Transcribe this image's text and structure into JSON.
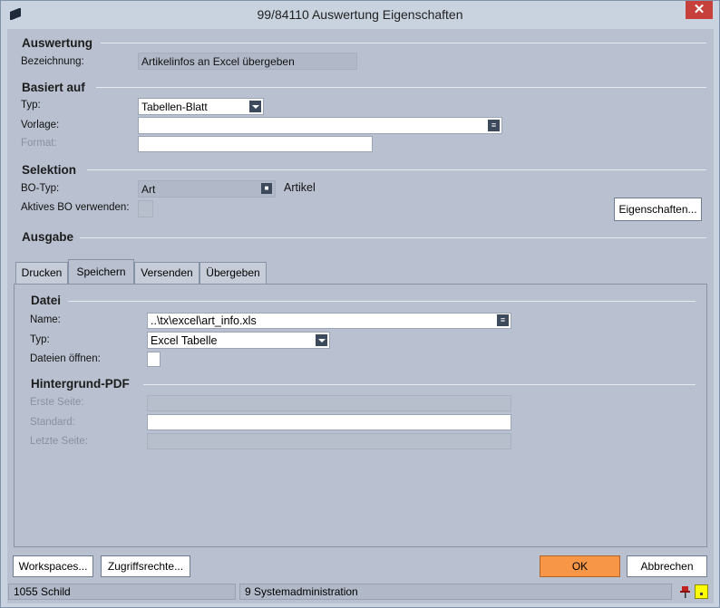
{
  "window": {
    "title": "99/84110 Auswertung Eigenschaften",
    "close_glyph": "✕"
  },
  "auswertung": {
    "title": "Auswertung",
    "bezeichnung_label": "Bezeichnung:",
    "bezeichnung_value": "Artikelinfos an Excel übergeben"
  },
  "basiert": {
    "title": "Basiert auf",
    "typ_label": "Typ:",
    "typ_value": "Tabellen-Blatt",
    "vorlage_label": "Vorlage:",
    "vorlage_value": "",
    "format_label": "Format:",
    "format_value": ""
  },
  "selektion": {
    "title": "Selektion",
    "botyp_label": "BO-Typ:",
    "botyp_value": "Art",
    "botyp_desc": "Artikel",
    "aktives_label": "Aktives BO verwenden:",
    "eigenschaften_button": "Eigenschaften..."
  },
  "ausgabe": {
    "title": "Ausgabe",
    "tabs": [
      "Drucken",
      "Speichern",
      "Versenden",
      "Übergeben"
    ],
    "active_tab": "Speichern"
  },
  "datei": {
    "title": "Datei",
    "name_label": "Name:",
    "name_value": "..\\tx\\excel\\art_info.xls",
    "typ_label": "Typ:",
    "typ_value": "Excel Tabelle",
    "oeffnen_label": "Dateien öffnen:"
  },
  "hintergrund": {
    "title": "Hintergrund-PDF",
    "erste_label": "Erste Seite:",
    "standard_label": "Standard:",
    "letzte_label": "Letzte Seite:"
  },
  "buttons": {
    "workspaces": "Workspaces...",
    "zugriffsrechte": "Zugriffsrechte...",
    "ok": "OK",
    "abbrechen": "Abbrechen"
  },
  "status": {
    "left": "1055 Schild",
    "middle": "9 Systemadministration"
  },
  "colors": {
    "ok_button": "#f79646",
    "close_button": "#c7413c",
    "note_icon": "#ffff00"
  }
}
